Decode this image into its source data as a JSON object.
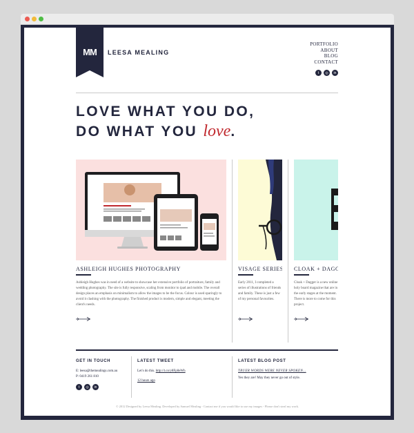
{
  "site": {
    "logo_mark": "MM",
    "logo_text": "LEESA MEALING"
  },
  "nav": [
    "PORTFOLIO",
    "ABOUT",
    "BLOG",
    "CONTACT"
  ],
  "social_icons": [
    "twitter-icon",
    "instagram-icon",
    "linkedin-icon"
  ],
  "hero": {
    "line1": "LOVE WHAT YOU DO,",
    "line2_prefix": "DO WHAT YOU ",
    "line2_em": "love",
    "line2_suffix": "."
  },
  "portfolio": [
    {
      "title": "ASHLEIGH HUGHES PHOTOGRAPHY",
      "body": "Ashleigh Hughes was in need of a website to showcase her extensive portfolio of portraiture, family and wedding photography. The site is fully responsive, scaling from monitor to ipad and mobile. The overall design places an emphasis on minimalism to allow the images to be the focus. Colour is used sparingly to avoid it clashing with the photography. The finished product is modern, simple and elegant, meeting the client's needs."
    },
    {
      "title": "VISAGE SERIES",
      "body": "Early 2011, I completed a series of illustrations of friends and family. These is just a few of my personal favourites."
    },
    {
      "title": "CLOAK + DAGGER",
      "body": "Cloak + Dagger is a new online holy board magazine that are in the early stages at the moment. There is more to come for this project."
    }
  ],
  "footer": {
    "get_in_touch": {
      "heading": "GET IN TOUCH",
      "email": "E: leesa@themealings.com.au",
      "phone": "P: 0419 261 810"
    },
    "latest_tweet": {
      "heading": "LATEST TWEET",
      "text": "Let's do this.",
      "link": "http://t.co/y8Fp0eWh",
      "time": "12 hours ago"
    },
    "latest_blog": {
      "heading": "LATEST BLOG POST",
      "title": "TRUER WORDS WERE NEVER SPOKEN...",
      "excerpt": "Yes they are! May they never go out of style."
    }
  },
  "copyright": "© 2012 Designed by Leesa Mealing. Developed by Samuel Mealing - Contact me if you would like to use my images - Please don't steal my work.",
  "colors": {
    "navy": "#23263d",
    "accent_red": "#c0282d",
    "pink_bg": "#fbe0df",
    "yellow_bg": "#fdfbd6",
    "mint_bg": "#c9f3ea"
  }
}
